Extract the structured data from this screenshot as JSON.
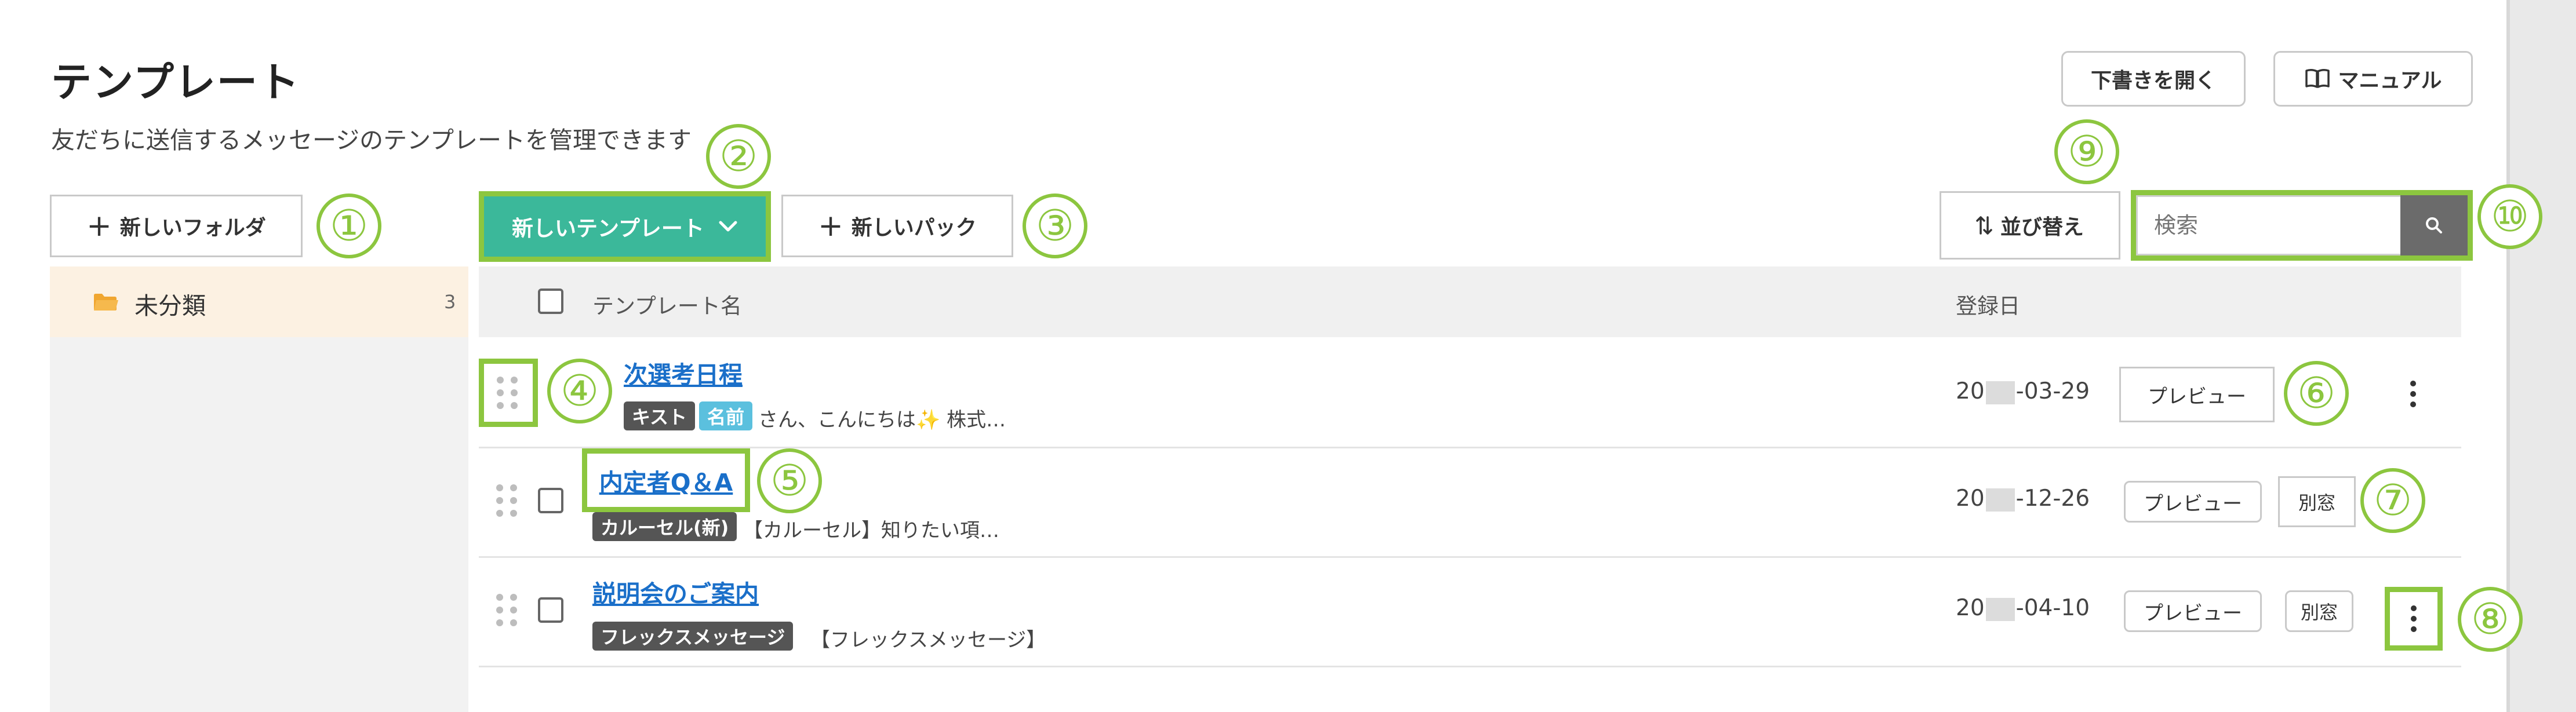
{
  "header": {
    "title": "テンプレート",
    "subtitle": "友だちに送信するメッセージのテンプレートを管理できます",
    "open_draft": "下書きを開く",
    "manual": "マニュアル"
  },
  "toolbar": {
    "new_folder": "新しいフォルダ",
    "new_template": "新しいテンプレート",
    "new_pack": "新しいパック",
    "sort": "並び替え",
    "search_placeholder": "検索"
  },
  "sidebar": {
    "folders": [
      {
        "name": "未分類",
        "count": "3"
      }
    ]
  },
  "table": {
    "columns": {
      "name": "テンプレート名",
      "date": "登録日"
    },
    "rows": [
      {
        "name": "次選考日程",
        "tags": [
          "キスト",
          "名前"
        ],
        "preview": "さん、こんにちは✨ 株式…",
        "date_prefix": "20",
        "date_suffix": "-03-29",
        "preview_button": "プレビュー"
      },
      {
        "name": "内定者Q＆A",
        "tags": [
          "カルーセル(新)"
        ],
        "preview": "【カルーセル】知りたい項…",
        "date_prefix": "20",
        "date_suffix": "-12-26",
        "preview_button": "プレビュー",
        "new_window_button": "別窓"
      },
      {
        "name": "説明会のご案内",
        "tags": [
          "フレックスメッセージ"
        ],
        "preview": "【フレックスメッセージ】",
        "date_prefix": "20",
        "date_suffix": "-04-10",
        "preview_button": "プレビュー",
        "new_window_button": "別窓"
      }
    ]
  },
  "annotations": [
    "①",
    "②",
    "③",
    "④",
    "⑤",
    "⑥",
    "⑦",
    "⑧",
    "⑨",
    "⑩"
  ],
  "colors": {
    "highlight": "#8cc63f",
    "primary": "#3bb89a",
    "link": "#1a6fc9",
    "tag_dark": "#555555",
    "tag_blue": "#5bc0de"
  }
}
